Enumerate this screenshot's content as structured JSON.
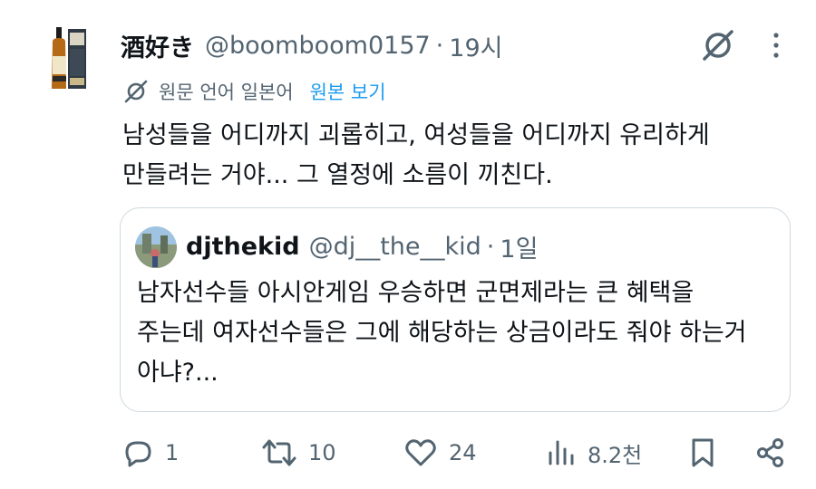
{
  "tweet": {
    "display_name": "酒好き",
    "handle": "@boomboom0157",
    "separator": "·",
    "time": "19시",
    "translation": {
      "label": "원문 언어 일본어",
      "link": "원본 보기"
    },
    "text_lines": [
      "남성들을 어디까지 괴롭히고, 여성들을 어디까지 유리하게",
      "만들려는 거야... 그 열정에 소름이 끼친다."
    ]
  },
  "quote": {
    "display_name": "djthekid",
    "handle": "@dj__the__kid",
    "separator": "·",
    "time": "1일",
    "text_lines": [
      "남자선수들 아시안게임 우승하면 군면제라는 큰 혜택을",
      "주는데 여자선수들은 그에 해당하는 상금이라도 줘야 하는거",
      "아냐?..."
    ]
  },
  "actions": {
    "reply_count": "1",
    "retweet_count": "10",
    "like_count": "24",
    "views_count": "8.2천"
  },
  "icons": [
    "grok-icon",
    "more-icon",
    "translate-icon",
    "reply-icon",
    "retweet-icon",
    "like-icon",
    "views-icon",
    "bookmark-icon",
    "share-icon"
  ],
  "colors": {
    "text": "#0f1419",
    "secondary": "#536471",
    "link": "#1d9bf0",
    "border": "#cfd9de"
  }
}
